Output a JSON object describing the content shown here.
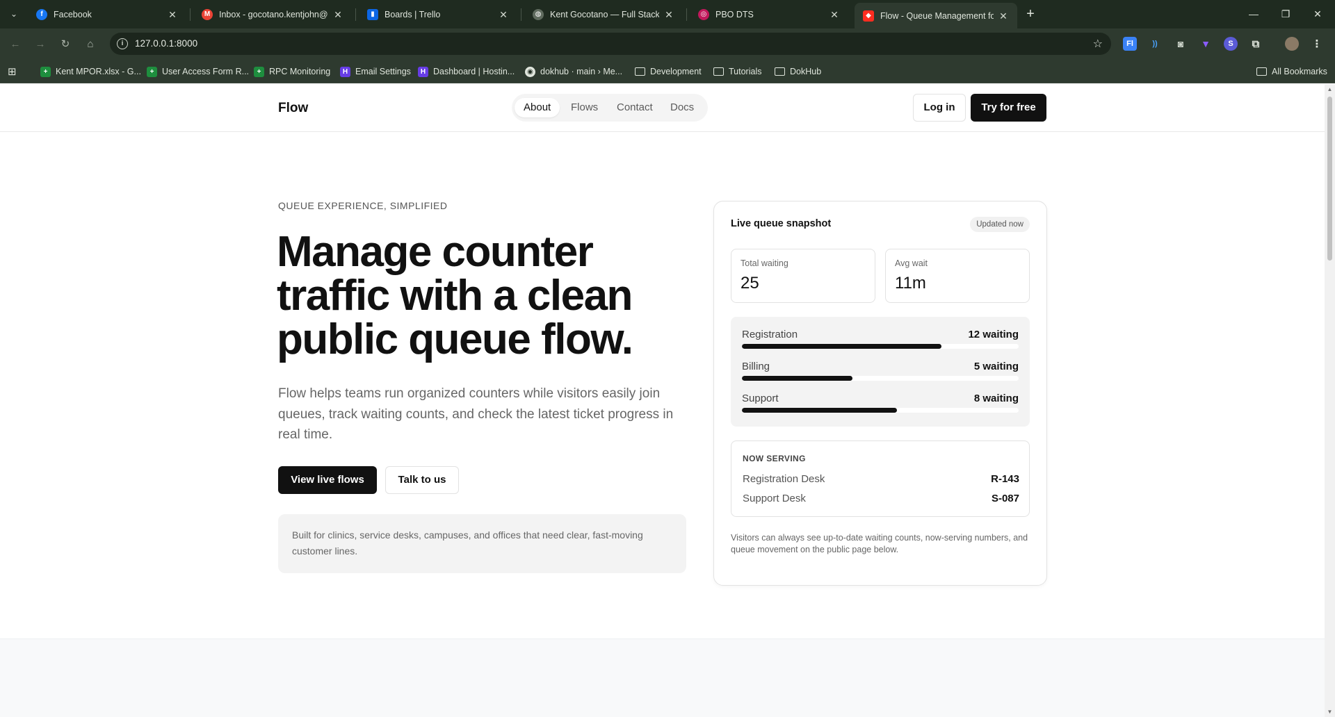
{
  "browser": {
    "tabs": [
      {
        "title": "Facebook",
        "favicon_color": "#1877f2",
        "favicon_glyph": "f"
      },
      {
        "title": "Inbox - gocotano.kentjohn@gmail.com",
        "favicon_color": "#ea4335",
        "favicon_glyph": "M"
      },
      {
        "title": "Boards | Trello",
        "favicon_color": "#0c66e4",
        "favicon_glyph": "▮"
      },
      {
        "title": "Kent Gocotano — Full Stack Developer",
        "favicon_color": "#5f6b5e",
        "favicon_glyph": "◍"
      },
      {
        "title": "PBO DTS",
        "favicon_color": "#c2185b",
        "favicon_glyph": "◎"
      },
      {
        "title": "Flow - Queue Management for",
        "favicon_color": "#ff2d20",
        "favicon_glyph": "◆"
      }
    ],
    "url": "127.0.0.1:8000",
    "bookmarks": [
      {
        "label": "Kent MPOR.xlsx - G...",
        "type": "sheet"
      },
      {
        "label": "User Access Form R...",
        "type": "sheet"
      },
      {
        "label": "RPC Monitoring",
        "type": "sheet"
      },
      {
        "label": "Email Settings",
        "type": "hostinger"
      },
      {
        "label": "Dashboard | Hostin...",
        "type": "hostinger"
      },
      {
        "label": "dokhub · main › Me...",
        "type": "repo"
      },
      {
        "label": "Development",
        "type": "folder"
      },
      {
        "label": "Tutorials",
        "type": "folder"
      },
      {
        "label": "DokHub",
        "type": "folder"
      }
    ],
    "all_bookmarks": "All Bookmarks"
  },
  "header": {
    "brand": "Flow",
    "nav": [
      "About",
      "Flows",
      "Contact",
      "Docs"
    ],
    "active_nav": "About",
    "login": "Log in",
    "try": "Try for free"
  },
  "hero": {
    "eyebrow": "QUEUE EXPERIENCE, SIMPLIFIED",
    "headline": "Manage counter traffic with a clean public queue flow.",
    "lede": "Flow helps teams run organized counters while visitors easily join queues, track waiting counts, and check the latest ticket progress in real time.",
    "primary_cta": "View live flows",
    "secondary_cta": "Talk to us",
    "note": "Built for clinics, service desks, campuses, and offices that need clear, fast-moving customer lines."
  },
  "snapshot": {
    "title": "Live queue snapshot",
    "badge": "Updated now",
    "stats": [
      {
        "label": "Total waiting",
        "value": "25"
      },
      {
        "label": "Avg wait",
        "value": "11m"
      }
    ],
    "queues": [
      {
        "name": "Registration",
        "count": "12 waiting",
        "progress": 0.72
      },
      {
        "name": "Billing",
        "count": "5 waiting",
        "progress": 0.4
      },
      {
        "name": "Support",
        "count": "8 waiting",
        "progress": 0.56
      }
    ],
    "now_serving_title": "NOW SERVING",
    "now_serving": [
      {
        "desk": "Registration Desk",
        "ticket": "R-143"
      },
      {
        "desk": "Support Desk",
        "ticket": "S-087"
      }
    ],
    "footer": "Visitors can always see up-to-date waiting counts, now-serving numbers, and queue movement on the public page below."
  }
}
